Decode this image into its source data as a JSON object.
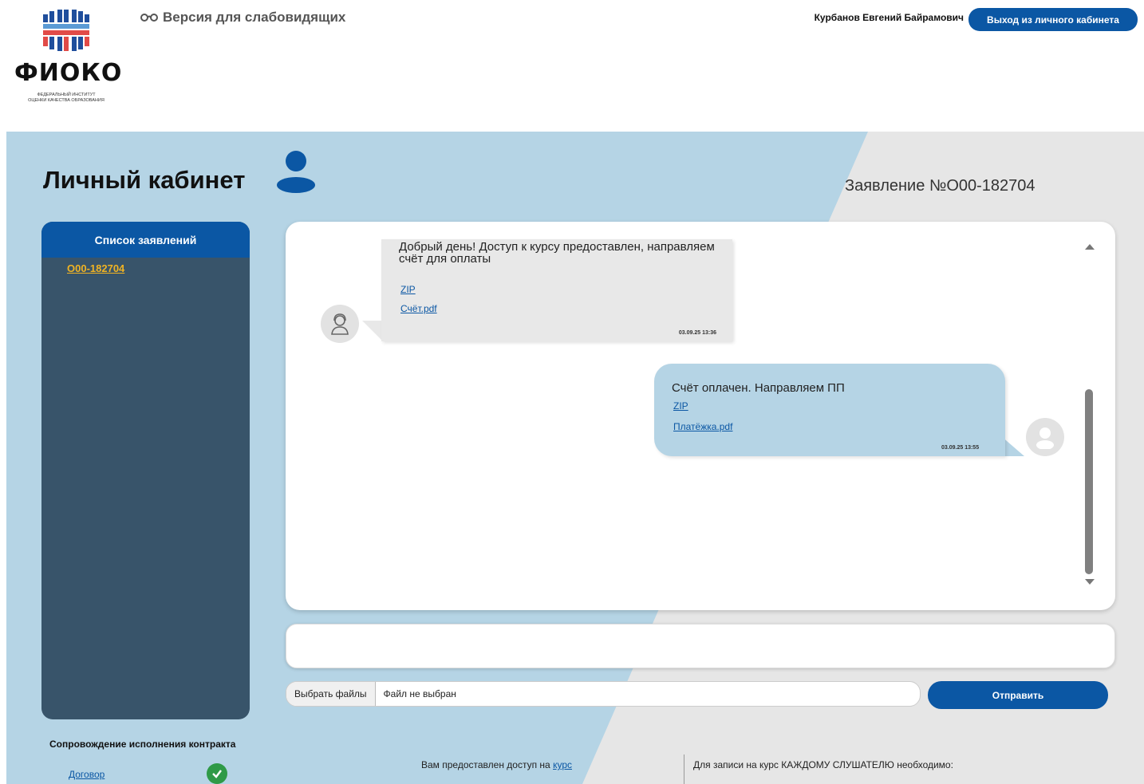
{
  "header": {
    "logo": {
      "name": "ФИОКО",
      "subtitle_line1": "Федеральный институт",
      "subtitle_line2": "оценки качества образования"
    },
    "accessibility_label": "Версия для слабовидящих",
    "user_name": "Курбанов Евгений Байрамович",
    "logout_label": "Выход из личного кабинета"
  },
  "page": {
    "title": "Личный кабинет",
    "application_number": "Заявление №О00-182704"
  },
  "sidebar": {
    "heading": "Список заявлений",
    "items": [
      {
        "label": "О00-182704"
      }
    ]
  },
  "chat": {
    "messages": [
      {
        "direction": "incoming",
        "text": "Добрый день! Доступ к курсу предоставлен, направляем счёт для оплаты",
        "attachments": [
          "ZIP",
          "Счёт.pdf"
        ],
        "time": "03.09.25 13:36"
      },
      {
        "direction": "outgoing",
        "text": "Счёт оплачен. Направляем ПП",
        "attachments": [
          "ZIP",
          "Платёжка.pdf"
        ],
        "time": "03.09.25 13:55"
      }
    ]
  },
  "compose": {
    "file_button_label": "Выбрать файлы",
    "file_status": "Файл не выбран",
    "send_label": "Отправить"
  },
  "footer": {
    "contract_title": "Сопровождение исполнения контракта",
    "contract_link": "Договор",
    "access_text": "Вам предоставлен доступ на",
    "access_link": "курс",
    "enroll_text": "Для записи на курс КАЖДОМУ СЛУШАТЕЛЮ необходимо:"
  },
  "colors": {
    "brand_blue": "#0b57a4",
    "band_light_blue": "#b5d4e5",
    "band_grey": "#e6e6e6",
    "sidebar_dark": "#38546a",
    "link_yellow": "#f0b323",
    "check_green": "#2f9a47"
  },
  "icons": [
    "glasses-icon",
    "user-icon",
    "operator-avatar-icon",
    "user-avatar-icon",
    "check-icon",
    "scroll-up-icon",
    "scroll-down-icon"
  ]
}
